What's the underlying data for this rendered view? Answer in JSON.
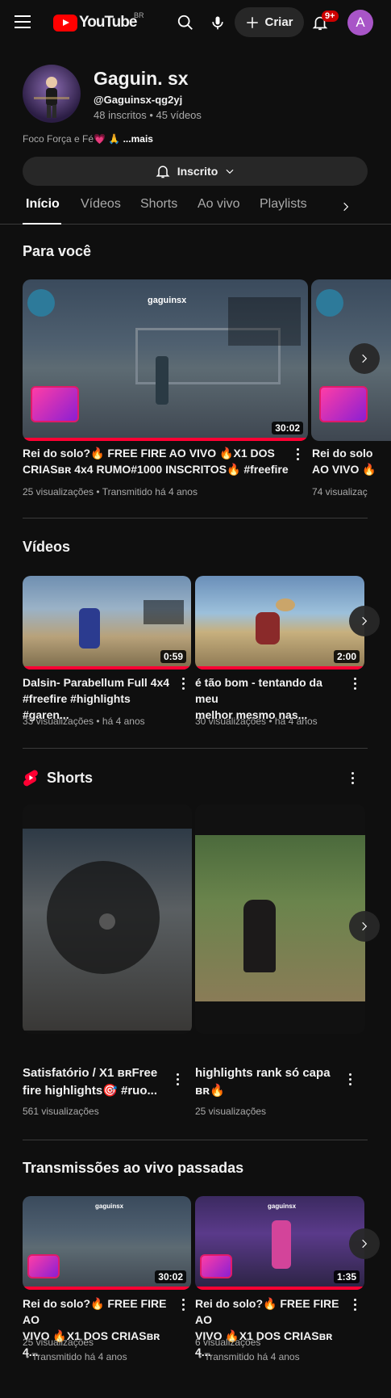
{
  "header": {
    "logo_text": "YouTube",
    "logo_region": "BR",
    "create_label": "Criar",
    "notifications_badge": "9+",
    "account_initial": "A"
  },
  "channel": {
    "name": "Gaguin. sx",
    "handle": "@Gaguinsx-qg2yj",
    "stats": "48 inscritos • 45 vídeos",
    "description": "Foco Força e Fé💗 🙏",
    "more_label": "...mais",
    "subscribed_label": "Inscrito"
  },
  "tabs": [
    {
      "label": "Início",
      "active": true
    },
    {
      "label": "Vídeos",
      "active": false
    },
    {
      "label": "Shorts",
      "active": false
    },
    {
      "label": "Ao vivo",
      "active": false
    },
    {
      "label": "Playlists",
      "active": false
    }
  ],
  "for_you": {
    "title": "Para você",
    "items": [
      {
        "thumb_text": "gaguinsx",
        "duration": "30:02",
        "title_line1": "Rei do solo?🔥 FREE FIRE AO VIVO 🔥X1 DOS",
        "title_line2": "CRIASʙʀ 4x4 RUMO#1000 INSCRITOS🔥 #freefire",
        "meta": "25 visualizações • Transmitido há 4 anos"
      },
      {
        "title_line1": "Rei do solo",
        "title_line2": "AO VIVO 🔥",
        "meta": "74 visualizaç"
      }
    ]
  },
  "videos": {
    "title": "Vídeos",
    "items": [
      {
        "duration": "0:59",
        "title_line1": "Dalsin- Parabellum Full 4x4",
        "title_line2": "#freefire #highlights #garen...",
        "meta": "33 visualizações • há 4 anos"
      },
      {
        "duration": "2:00",
        "title_line1": "é tão bom - tentando da meu",
        "title_line2": "melhor mesmo nas...",
        "meta": "30 visualizações • há 4 anos"
      }
    ]
  },
  "shorts": {
    "title": "Shorts",
    "items": [
      {
        "title_line1": "Satisfatório / X1 ʙʀFree",
        "title_line2": "fire highlights🎯 #ruo...",
        "meta": "561 visualizações"
      },
      {
        "title_line1": "highlights rank só capa",
        "title_line2": "ʙʀ🔥",
        "meta": "25 visualizações"
      }
    ]
  },
  "past_live": {
    "title": "Transmissões ao vivo passadas",
    "items": [
      {
        "thumb_text": "gaguinsx",
        "duration": "30:02",
        "title_line1": "Rei do solo?🔥 FREE FIRE AO",
        "title_line2": "VIVO 🔥X1 DOS CRIASʙʀ 4...",
        "meta_line1": "25 visualizações",
        "meta_line2": "• Transmitido há 4 anos"
      },
      {
        "thumb_text": "gaguinsx",
        "duration": "1:35",
        "title_line1": "Rei do solo?🔥 FREE FIRE AO",
        "title_line2": "VIVO 🔥X1 DOS CRIASʙʀ 4...",
        "meta_line1": "6 visualizações",
        "meta_line2": "• Transmitido há 4 anos"
      }
    ]
  },
  "colors": {
    "background": "#0f0f0f",
    "accent_red": "#ff0000",
    "progress_red": "#ff0033",
    "chip_bg": "#272727",
    "muted_text": "#aaaaaa"
  }
}
